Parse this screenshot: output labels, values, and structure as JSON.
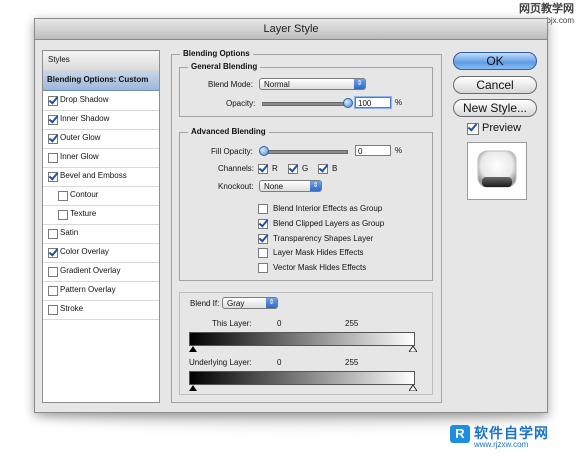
{
  "watermark_top": {
    "line1": "网页教学网",
    "line2": "www.webjx.com"
  },
  "watermark_bottom": {
    "logo": "R",
    "line1": "软件自学网",
    "line2": "www.rjzxw.com"
  },
  "window": {
    "title": "Layer Style"
  },
  "sidebar": {
    "header": "Styles",
    "items": [
      {
        "label": "Blending Options: Custom",
        "checked": null,
        "selected": true
      },
      {
        "label": "Drop Shadow",
        "checked": true
      },
      {
        "label": "Inner Shadow",
        "checked": true
      },
      {
        "label": "Outer Glow",
        "checked": true
      },
      {
        "label": "Inner Glow",
        "checked": false
      },
      {
        "label": "Bevel and Emboss",
        "checked": true
      },
      {
        "label": "Contour",
        "checked": false
      },
      {
        "label": "Texture",
        "checked": false
      },
      {
        "label": "Satin",
        "checked": false
      },
      {
        "label": "Color Overlay",
        "checked": true
      },
      {
        "label": "Gradient Overlay",
        "checked": false
      },
      {
        "label": "Pattern Overlay",
        "checked": false
      },
      {
        "label": "Stroke",
        "checked": false
      }
    ]
  },
  "blending": {
    "title": "Blending Options",
    "general": {
      "title": "General Blending",
      "blend_mode_label": "Blend Mode:",
      "blend_mode_value": "Normal",
      "opacity_label": "Opacity:",
      "opacity_value": "100",
      "opacity_unit": "%"
    },
    "advanced": {
      "title": "Advanced Blending",
      "fill_opacity_label": "Fill Opacity:",
      "fill_opacity_value": "0",
      "fill_opacity_unit": "%",
      "channels_label": "Channels:",
      "channels": [
        {
          "label": "R",
          "checked": true
        },
        {
          "label": "G",
          "checked": true
        },
        {
          "label": "B",
          "checked": true
        }
      ],
      "knockout_label": "Knockout:",
      "knockout_value": "None",
      "options": [
        {
          "label": "Blend Interior Effects as Group",
          "checked": false
        },
        {
          "label": "Blend Clipped Layers as Group",
          "checked": true
        },
        {
          "label": "Transparency Shapes Layer",
          "checked": true
        },
        {
          "label": "Layer Mask Hides Effects",
          "checked": false
        },
        {
          "label": "Vector Mask Hides Effects",
          "checked": false
        }
      ]
    },
    "blend_if": {
      "label": "Blend If:",
      "value": "Gray",
      "this_layer": {
        "label": "This Layer:",
        "low": "0",
        "high": "255"
      },
      "underlying_layer": {
        "label": "Underlying Layer:",
        "low": "0",
        "high": "255"
      }
    }
  },
  "buttons": {
    "ok": "OK",
    "cancel": "Cancel",
    "new_style": "New Style..."
  },
  "preview": {
    "label": "Preview",
    "checked": true
  },
  "colors": {
    "accent": "#3f7fd8",
    "selection": "#a9c0e0"
  }
}
